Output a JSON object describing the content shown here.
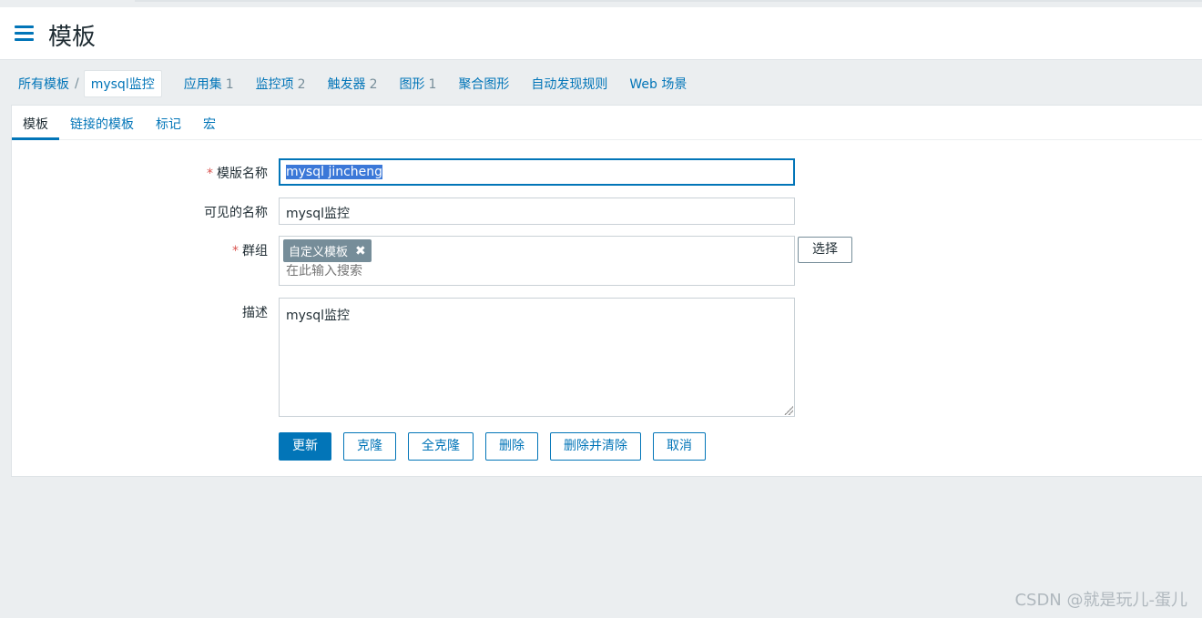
{
  "header": {
    "title": "模板",
    "menu_icon": "hamburger-menu-icon"
  },
  "breadcrumb": {
    "root": "所有模板",
    "separator": "/",
    "current": "mysql监控",
    "items": [
      {
        "label": "应用集",
        "count": "1"
      },
      {
        "label": "监控项",
        "count": "2"
      },
      {
        "label": "触发器",
        "count": "2"
      },
      {
        "label": "图形",
        "count": "1"
      },
      {
        "label": "聚合图形",
        "count": ""
      },
      {
        "label": "自动发现规则",
        "count": ""
      },
      {
        "label": "Web 场景",
        "count": ""
      }
    ]
  },
  "tabs": [
    {
      "label": "模板",
      "active": true
    },
    {
      "label": "链接的模板",
      "active": false
    },
    {
      "label": "标记",
      "active": false
    },
    {
      "label": "宏",
      "active": false
    }
  ],
  "form": {
    "required_mark": "*",
    "template_name": {
      "label": "模版名称",
      "value": "mysql jincheng"
    },
    "visible_name": {
      "label": "可见的名称",
      "value": "mysql监控"
    },
    "groups": {
      "label": "群组",
      "chip": "自定义模板",
      "chip_remove": "✖",
      "placeholder": "在此输入搜索",
      "select_button": "选择"
    },
    "description": {
      "label": "描述",
      "value": "mysql监控"
    }
  },
  "buttons": {
    "update": "更新",
    "clone": "克隆",
    "full_clone": "全克隆",
    "delete": "删除",
    "delete_and_clear": "删除并清除",
    "cancel": "取消"
  },
  "watermark": "CSDN @就是玩儿-蛋儿",
  "colors": {
    "accent": "#0275b8",
    "background": "#ebeef0",
    "required": "#d9534f"
  }
}
